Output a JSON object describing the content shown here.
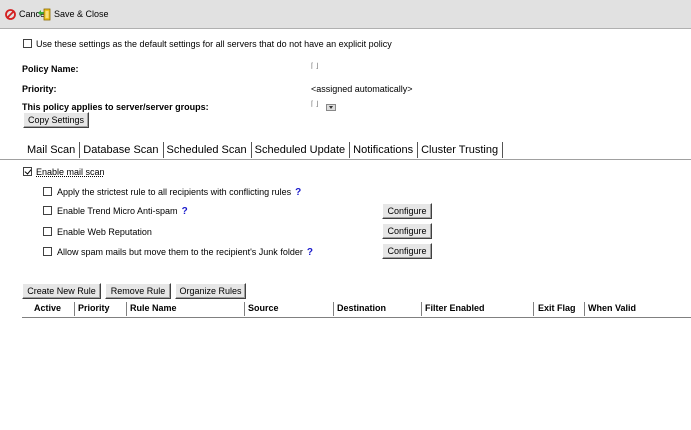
{
  "toolbar": {
    "cancel_label": "Cancel",
    "save_close_label": "Save & Close"
  },
  "settings": {
    "default_policy_label": "Use these settings as the default settings for all servers that do not have an explicit policy",
    "default_policy_checked": false,
    "policy_name_label": "Policy Name:",
    "priority_label": "Priority:",
    "priority_value": "<assigned automatically>",
    "applies_to_label": "This policy applies to server/server groups:",
    "copy_settings_label": "Copy Settings"
  },
  "tabs": [
    {
      "label": "Mail Scan",
      "active": true
    },
    {
      "label": "Database Scan"
    },
    {
      "label": "Scheduled Scan"
    },
    {
      "label": "Scheduled Update"
    },
    {
      "label": "Notifications"
    },
    {
      "label": "Cluster Trusting"
    }
  ],
  "mail_scan": {
    "enable_label": "Enable mail scan",
    "enable_checked": true,
    "options": [
      {
        "label": "Apply the strictest rule to all recipients with conflicting rules",
        "help": "?",
        "checked": false
      },
      {
        "label": "Enable Trend Micro Anti-spam",
        "help": "?",
        "checked": false,
        "configure": "Configure"
      },
      {
        "label": "Enable Web Reputation",
        "checked": false,
        "configure": "Configure"
      },
      {
        "label": "Allow spam mails but move them to the recipient's Junk folder",
        "help": "?",
        "checked": false,
        "configure": "Configure"
      }
    ]
  },
  "rules": {
    "create_label": "Create New Rule",
    "remove_label": "Remove Rule",
    "organize_label": "Organize Rules",
    "columns": [
      "Active",
      "Priority",
      "Rule Name",
      "Source",
      "Destination",
      "Filter Enabled",
      "Exit Flag",
      "When Valid"
    ],
    "rows": []
  },
  "colors": {
    "toolbar_bg": "#e1e1e1",
    "help_blue": "#1a1acc",
    "cancel_red": "#d42020"
  }
}
